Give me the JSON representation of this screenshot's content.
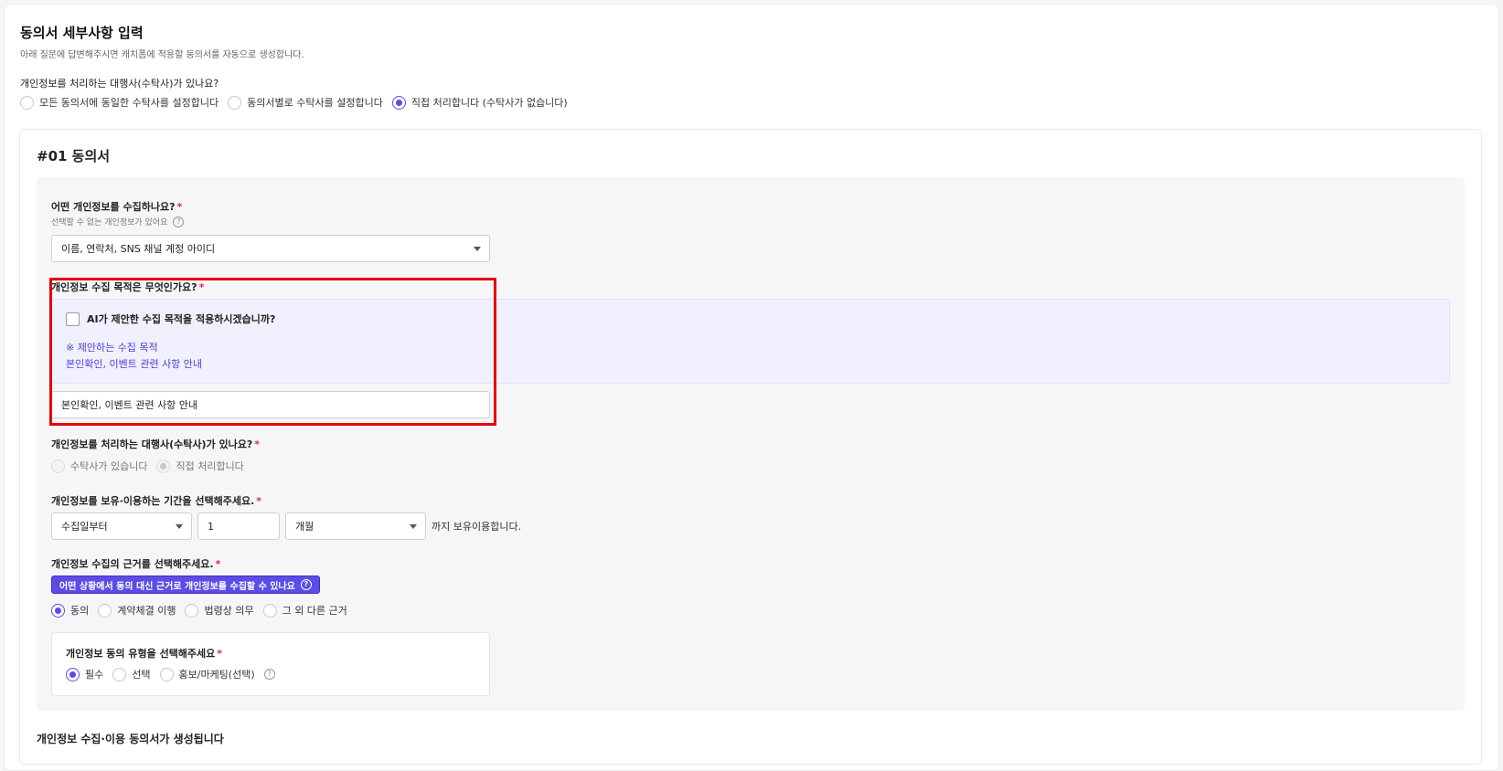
{
  "page": {
    "title": "동의서 세부사항 입력",
    "description": "아래 질문에 답변해주시면 캐치폼에 적용할 동의서를 자동으로 생성합니다."
  },
  "global_processor": {
    "question": "개인정보를 처리하는 대행사(수탁사)가 있나요?",
    "options": [
      {
        "label": "모든 동의서에 동일한 수탁사를 설정합니다",
        "checked": false
      },
      {
        "label": "동의서별로 수탁사를 설정합니다",
        "checked": false
      },
      {
        "label": "직접 처리합니다 (수탁사가 없습니다)",
        "checked": true
      }
    ]
  },
  "consent": {
    "title": "#01 동의서",
    "collect_items": {
      "question": "어떤 개인정보를 수집하나요?",
      "required_mark": "*",
      "hint": "선택할 수 없는 개인정보가 있어요",
      "selected": "이름, 연락처, SNS 채널 계정 아이디"
    },
    "purpose": {
      "question": "개인정보 수집 목적은 무엇인가요?",
      "required_mark": "*",
      "ai_checkbox_label": "AI가 제안한 수집 목적을 적용하시겠습니까?",
      "ai_checked": false,
      "suggest_title": "※ 제안하는 수집 목적",
      "suggest_value": "본인확인, 이벤트 관련 사항 안내",
      "input_value": "본인확인, 이벤트 관련 사항 안내"
    },
    "processor": {
      "question": "개인정보를 처리하는 대행사(수탁사)가 있나요?",
      "required_mark": "*",
      "options": [
        {
          "label": "수탁사가 있습니다",
          "checked": false
        },
        {
          "label": "직접 처리합니다",
          "checked": true
        }
      ]
    },
    "retention": {
      "question": "개인정보를 보유·이용하는 기간을 선택해주세요.",
      "required_mark": "*",
      "start": "수집일부터",
      "amount": "1",
      "unit": "개월",
      "suffix": "까지 보유이용합니다."
    },
    "basis": {
      "question": "개인정보 수집의 근거를 선택해주세요.",
      "required_mark": "*",
      "info_button": "어떤 상황에서 동의 대신 근거로 개인정보를 수집할 수 있나요",
      "options": [
        {
          "label": "동의",
          "checked": true
        },
        {
          "label": "계약체결 이행",
          "checked": false
        },
        {
          "label": "법령상 의무",
          "checked": false
        },
        {
          "label": "그 외 다른 근거",
          "checked": false
        }
      ]
    },
    "consent_type": {
      "question": "개인정보 동의 유형을 선택해주세요",
      "required_mark": "*",
      "options": [
        {
          "label": "필수",
          "checked": true
        },
        {
          "label": "선택",
          "checked": false
        },
        {
          "label": "홍보/마케팅(선택)",
          "checked": false
        }
      ]
    }
  },
  "footer": {
    "label": "개인정보 수집·이용 동의서가 생성됩니다"
  },
  "colors": {
    "accent": "#5a4de0",
    "highlight_border": "#e60000",
    "required": "#e0245e"
  }
}
